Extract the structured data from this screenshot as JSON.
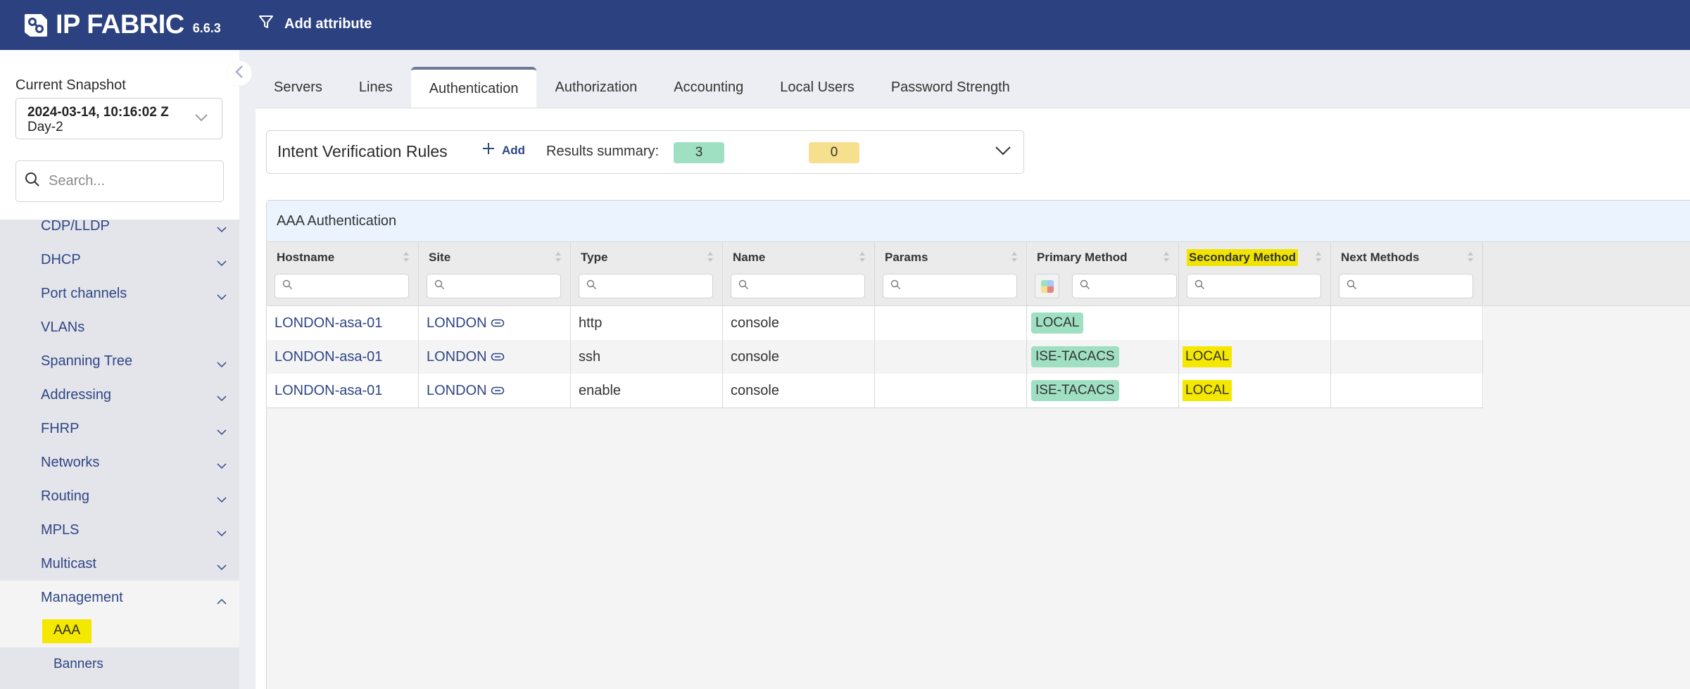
{
  "header": {
    "brand": "IP FABRIC",
    "version": "6.6.3",
    "add_attribute_label": "Add attribute",
    "logo_icon": "ip-fabric-logo-icon",
    "filter_icon": "funnel-icon"
  },
  "sidebar": {
    "snapshot_label": "Current Snapshot",
    "snapshot_date": "2024-03-14, 10:16:02 Z",
    "snapshot_name": "Day-2",
    "search_placeholder": "Search...",
    "items": [
      {
        "label": "CDP/LLDP",
        "expandable": true
      },
      {
        "label": "DHCP",
        "expandable": true
      },
      {
        "label": "Port channels",
        "expandable": true
      },
      {
        "label": "VLANs",
        "expandable": false
      },
      {
        "label": "Spanning Tree",
        "expandable": true
      },
      {
        "label": "Addressing",
        "expandable": true
      },
      {
        "label": "FHRP",
        "expandable": true
      },
      {
        "label": "Networks",
        "expandable": true
      },
      {
        "label": "Routing",
        "expandable": true
      },
      {
        "label": "MPLS",
        "expandable": true
      },
      {
        "label": "Multicast",
        "expandable": true
      },
      {
        "label": "Management",
        "expandable": true,
        "expanded": true
      }
    ],
    "sub_items": [
      {
        "label": "AAA",
        "active": true,
        "highlighted": true
      },
      {
        "label": "Banners",
        "active": false
      }
    ]
  },
  "tabs": [
    {
      "label": "Servers",
      "active": false
    },
    {
      "label": "Lines",
      "active": false
    },
    {
      "label": "Authentication",
      "active": true
    },
    {
      "label": "Authorization",
      "active": false
    },
    {
      "label": "Accounting",
      "active": false
    },
    {
      "label": "Local Users",
      "active": false
    },
    {
      "label": "Password Strength",
      "active": false
    }
  ],
  "ivr": {
    "title": "Intent Verification Rules",
    "add_label": "Add",
    "summary_label": "Results summary:",
    "green_count": "3",
    "yellow_count": "0"
  },
  "table": {
    "title": "AAA Authentication",
    "columns": [
      {
        "label": "Hostname",
        "highlighted": false
      },
      {
        "label": "Site",
        "highlighted": false
      },
      {
        "label": "Type",
        "highlighted": false
      },
      {
        "label": "Name",
        "highlighted": false
      },
      {
        "label": "Params",
        "highlighted": false
      },
      {
        "label": "Primary Method",
        "highlighted": false,
        "color_filter": true
      },
      {
        "label": "Secondary Method",
        "highlighted": true
      },
      {
        "label": "Next Methods",
        "highlighted": false
      }
    ],
    "rows": [
      {
        "hostname": "LONDON-asa-01",
        "site": "LONDON",
        "type": "http",
        "name": "console",
        "params": "",
        "primary": "LOCAL",
        "secondary": "",
        "next": ""
      },
      {
        "hostname": "LONDON-asa-01",
        "site": "LONDON",
        "type": "ssh",
        "name": "console",
        "params": "",
        "primary": "ISE-TACACS",
        "secondary": "LOCAL",
        "next": ""
      },
      {
        "hostname": "LONDON-asa-01",
        "site": "LONDON",
        "type": "enable",
        "name": "console",
        "params": "",
        "primary": "ISE-TACACS",
        "secondary": "LOCAL",
        "next": ""
      }
    ]
  },
  "colors": {
    "brand": "#2c4180",
    "link": "#2f4585",
    "badge_green": "#9fe0c3",
    "badge_yellow": "#f7e08d",
    "highlight": "#f5e800"
  }
}
